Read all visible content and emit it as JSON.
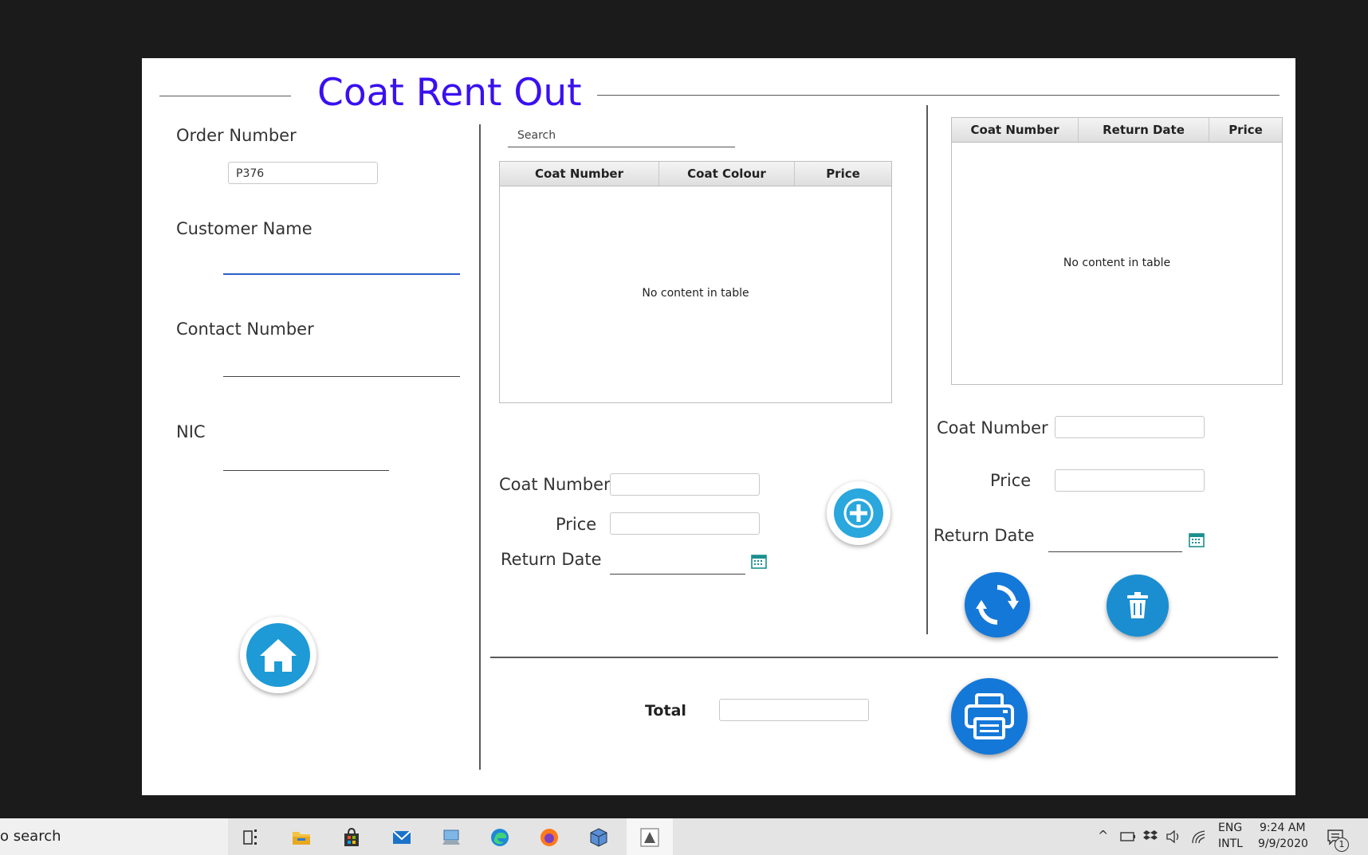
{
  "window": {
    "title": "Coat Rent Out"
  },
  "customer": {
    "order_number_label": "Order Number",
    "order_number_value": "P376",
    "customer_name_label": "Customer Name",
    "customer_name_value": "",
    "contact_number_label": "Contact Number",
    "contact_number_value": "",
    "nic_label": "NIC",
    "nic_value": ""
  },
  "catalog": {
    "search_placeholder": "Search",
    "columns": [
      "Coat Number",
      "Coat Colour",
      "Price"
    ],
    "empty_text": "No content in table",
    "coat_number_label": "Coat Number",
    "price_label": "Price",
    "return_date_label": "Return Date"
  },
  "cart": {
    "columns": [
      "Coat Number",
      "Return Date",
      "Price"
    ],
    "empty_text": "No content in table",
    "coat_number_label": "Coat Number",
    "price_label": "Price",
    "return_date_label": "Return Date"
  },
  "footer": {
    "total_label": "Total",
    "total_value": ""
  },
  "icons": {
    "home": "home-icon",
    "add": "plus-icon",
    "refresh": "refresh-icon",
    "delete": "trash-icon",
    "print": "printer-icon",
    "calendar": "calendar-icon"
  },
  "colors": {
    "title": "#3a10f0",
    "button": "#1e9ad6",
    "field_active": "#2d5fc9"
  },
  "taskbar": {
    "search_text": "o search",
    "language": "ENG",
    "layout": "INTL",
    "time": "9:24 AM",
    "date": "9/9/2020",
    "notification_count": "1"
  }
}
